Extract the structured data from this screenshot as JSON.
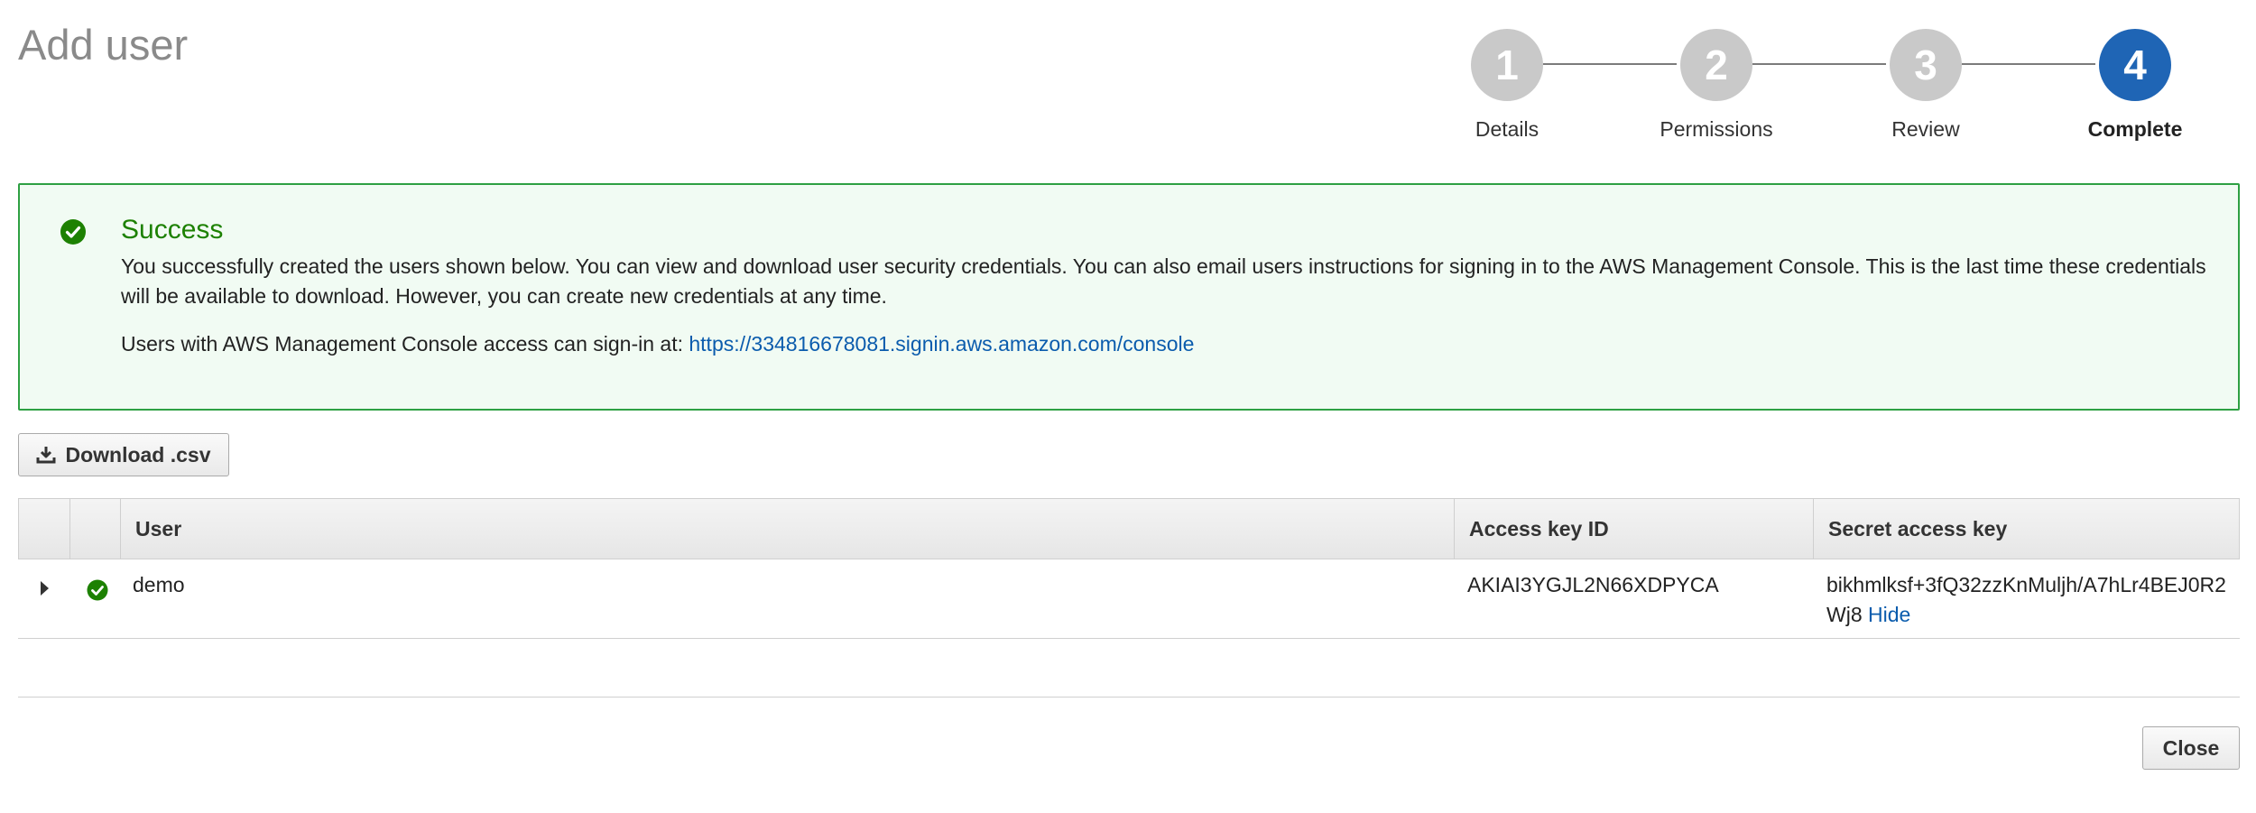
{
  "page": {
    "title": "Add user"
  },
  "wizard": {
    "steps": [
      {
        "number": "1",
        "label": "Details",
        "active": false
      },
      {
        "number": "2",
        "label": "Permissions",
        "active": false
      },
      {
        "number": "3",
        "label": "Review",
        "active": false
      },
      {
        "number": "4",
        "label": "Complete",
        "active": true
      }
    ]
  },
  "alert": {
    "icon": "check-circle-icon",
    "title": "Success",
    "body": "You successfully created the users shown below. You can view and download user security credentials. You can also email users instructions for signing in to the AWS Management Console. This is the last time these credentials will be available to download. However, you can create new credentials at any time.",
    "signin_prefix": "Users with AWS Management Console access can sign-in at: ",
    "signin_url": "https://334816678081.signin.aws.amazon.com/console"
  },
  "toolbar": {
    "download_label": "Download .csv",
    "download_icon": "download-icon"
  },
  "table": {
    "columns": [
      "User",
      "Access key ID",
      "Secret access key"
    ],
    "rows": [
      {
        "user": "demo",
        "access_key_id": "AKIAI3YGJL2N66XDPYCA",
        "secret_access_key": "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",
        "hide_label": "Hide",
        "status_icon": "check-circle-icon"
      }
    ]
  },
  "footer": {
    "close_label": "Close"
  },
  "colors": {
    "success_green": "#1d8102",
    "active_step": "#1f65b5",
    "inactive_step": "#c9c9c9",
    "link_blue": "#0b5cad"
  }
}
